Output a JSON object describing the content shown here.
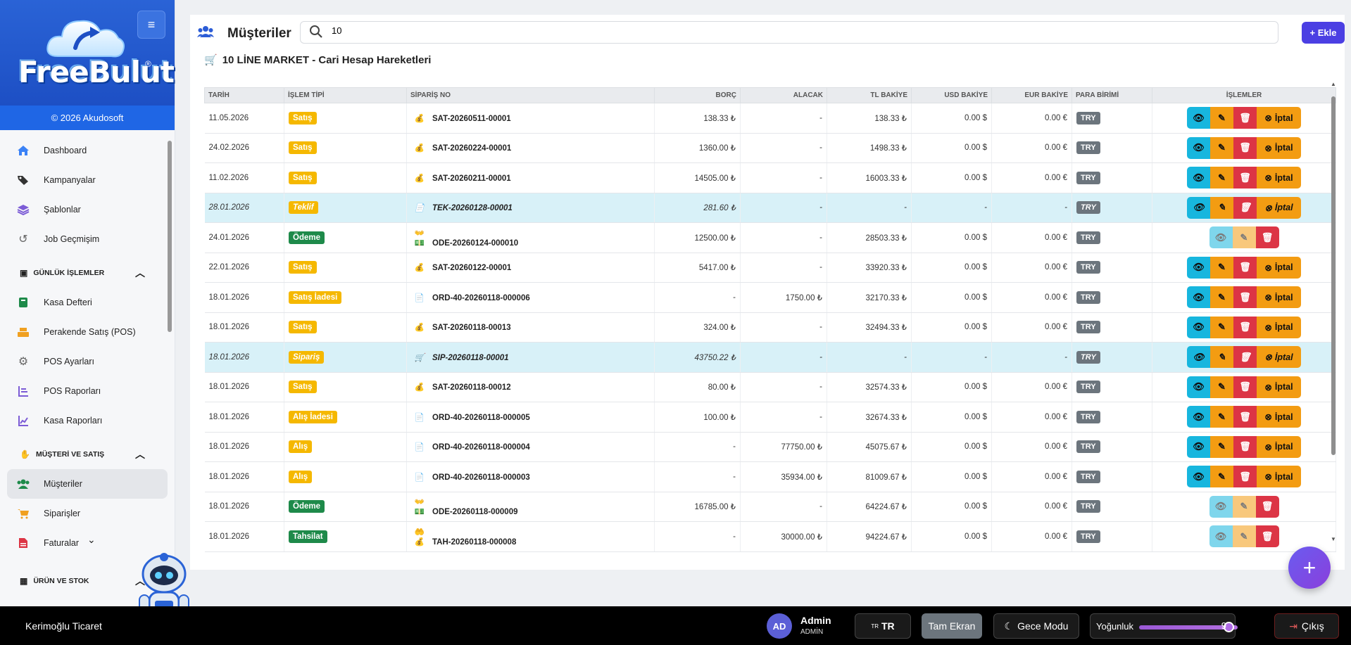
{
  "brand": {
    "logo_text": "FreeBulut",
    "reg": "®",
    "copyright": "© 2026 Akudosoft",
    "menu_icon": "hamburger-icon"
  },
  "sidebar": {
    "items": [
      {
        "label": "Dashboard",
        "icon": "home-icon",
        "color": "#3b82f6"
      },
      {
        "label": "Kampanyalar",
        "icon": "tags-icon",
        "color": "#333333"
      },
      {
        "label": "Şablonlar",
        "icon": "layers-icon",
        "color": "#7c5cd6"
      },
      {
        "label": "Job Geçmişim",
        "icon": "history-icon",
        "color": "#666666"
      }
    ],
    "section1": "GÜNLÜK İŞLEMLER",
    "items2": [
      {
        "label": "Kasa Defteri",
        "icon": "book-icon",
        "color": "#1e8a4a"
      },
      {
        "label": "Perakende Satış (POS)",
        "icon": "cash-register-icon",
        "color": "#f0a020"
      },
      {
        "label": "POS Ayarları",
        "icon": "gear-icon",
        "color": "#666666"
      },
      {
        "label": "POS Raporları",
        "icon": "list-icon",
        "color": "#7c5cd6"
      },
      {
        "label": "Kasa Raporları",
        "icon": "chart-line-icon",
        "color": "#7c5cd6"
      }
    ],
    "section2": "MÜŞTERİ VE SATIŞ",
    "items3": [
      {
        "label": "Müşteriler",
        "icon": "users-icon",
        "color": "#1e8a4a"
      },
      {
        "label": "Siparişler",
        "icon": "cart-icon",
        "color": "#f0a020"
      },
      {
        "label": "Faturalar",
        "icon": "invoice-icon",
        "color": "#dc3545"
      }
    ],
    "section3": "ÜRÜN VE STOK"
  },
  "header": {
    "title": "Müşteriler",
    "search_value": "10",
    "add_label": "+ Ekle"
  },
  "sub_title": "10 LİNE MARKET - Cari Hesap Hareketleri",
  "table": {
    "headers": [
      "TARİH",
      "İŞLEM TİPİ",
      "SİPARİŞ NO",
      "BORÇ",
      "ALACAK",
      "TL BAKİYE",
      "USD BAKİYE",
      "EUR BAKİYE",
      "PARA BİRİMİ",
      "İŞLEMLER"
    ],
    "rows": [
      {
        "date": "11.05.2026",
        "type": "Satış",
        "badge": "yellow",
        "icons": "💰",
        "no": "SAT-20260511-00001",
        "borc": "138.33 ₺",
        "alacak": "-",
        "tl": "138.33 ₺",
        "usd": "0.00 $",
        "eur": "0.00 €",
        "cur": "TRY",
        "tl_color": "red",
        "hl": false,
        "actions": "full"
      },
      {
        "date": "24.02.2026",
        "type": "Satış",
        "badge": "yellow",
        "icons": "💰",
        "no": "SAT-20260224-00001",
        "borc": "1360.00 ₺",
        "alacak": "-",
        "tl": "1498.33 ₺",
        "usd": "0.00 $",
        "eur": "0.00 €",
        "cur": "TRY",
        "tl_color": "red",
        "hl": false,
        "actions": "full"
      },
      {
        "date": "11.02.2026",
        "type": "Satış",
        "badge": "yellow",
        "icons": "💰",
        "no": "SAT-20260211-00001",
        "borc": "14505.00 ₺",
        "alacak": "-",
        "tl": "16003.33 ₺",
        "usd": "0.00 $",
        "eur": "0.00 €",
        "cur": "TRY",
        "tl_color": "red",
        "hl": false,
        "actions": "full"
      },
      {
        "date": "28.01.2026",
        "type": "Teklif",
        "badge": "yellow",
        "icons": "📄",
        "no": "TEK-20260128-00001",
        "borc": "281.60 ₺",
        "alacak": "-",
        "tl": "-",
        "usd": "-",
        "eur": "-",
        "cur": "TRY",
        "tl_color": "grey",
        "hl": true,
        "actions": "full"
      },
      {
        "date": "24.01.2026",
        "type": "Ödeme",
        "badge": "green",
        "icons": "👐💵",
        "no": "ODE-20260124-000010",
        "borc": "12500.00 ₺",
        "alacak": "-",
        "tl": "28503.33 ₺",
        "usd": "0.00 $",
        "eur": "0.00 €",
        "cur": "TRY",
        "tl_color": "red",
        "hl": false,
        "actions": "faded"
      },
      {
        "date": "22.01.2026",
        "type": "Satış",
        "badge": "yellow",
        "icons": "💰",
        "no": "SAT-20260122-00001",
        "borc": "5417.00 ₺",
        "alacak": "-",
        "tl": "33920.33 ₺",
        "usd": "0.00 $",
        "eur": "0.00 €",
        "cur": "TRY",
        "tl_color": "red",
        "hl": false,
        "actions": "full"
      },
      {
        "date": "18.01.2026",
        "type": "Satış İadesi",
        "badge": "yellow",
        "icons": "📄",
        "no": "ORD-40-20260118-000006",
        "borc": "-",
        "alacak": "1750.00 ₺",
        "tl": "32170.33 ₺",
        "usd": "0.00 $",
        "eur": "0.00 €",
        "cur": "TRY",
        "tl_color": "red",
        "hl": false,
        "actions": "full"
      },
      {
        "date": "18.01.2026",
        "type": "Satış",
        "badge": "yellow",
        "icons": "💰",
        "no": "SAT-20260118-00013",
        "borc": "324.00 ₺",
        "alacak": "-",
        "tl": "32494.33 ₺",
        "usd": "0.00 $",
        "eur": "0.00 €",
        "cur": "TRY",
        "tl_color": "red",
        "hl": false,
        "actions": "full"
      },
      {
        "date": "18.01.2026",
        "type": "Sipariş",
        "badge": "yellow",
        "icons": "🛒",
        "no": "SIP-20260118-00001",
        "borc": "43750.22 ₺",
        "alacak": "-",
        "tl": "-",
        "usd": "-",
        "eur": "-",
        "cur": "TRY",
        "tl_color": "grey",
        "hl": true,
        "actions": "full"
      },
      {
        "date": "18.01.2026",
        "type": "Satış",
        "badge": "yellow",
        "icons": "💰",
        "no": "SAT-20260118-00012",
        "borc": "80.00 ₺",
        "alacak": "-",
        "tl": "32574.33 ₺",
        "usd": "0.00 $",
        "eur": "0.00 €",
        "cur": "TRY",
        "tl_color": "red",
        "hl": false,
        "actions": "full"
      },
      {
        "date": "18.01.2026",
        "type": "Alış İadesi",
        "badge": "yellow",
        "icons": "📄",
        "no": "ORD-40-20260118-000005",
        "borc": "100.00 ₺",
        "alacak": "-",
        "tl": "32674.33 ₺",
        "usd": "0.00 $",
        "eur": "0.00 €",
        "cur": "TRY",
        "tl_color": "red",
        "hl": false,
        "actions": "full"
      },
      {
        "date": "18.01.2026",
        "type": "Alış",
        "badge": "yellow",
        "icons": "📄",
        "no": "ORD-40-20260118-000004",
        "borc": "-",
        "alacak": "77750.00 ₺",
        "tl": "45075.67 ₺",
        "usd": "0.00 $",
        "eur": "0.00 €",
        "cur": "TRY",
        "tl_color": "green",
        "hl": false,
        "actions": "full"
      },
      {
        "date": "18.01.2026",
        "type": "Alış",
        "badge": "yellow",
        "icons": "📄",
        "no": "ORD-40-20260118-000003",
        "borc": "-",
        "alacak": "35934.00 ₺",
        "tl": "81009.67 ₺",
        "usd": "0.00 $",
        "eur": "0.00 €",
        "cur": "TRY",
        "tl_color": "green",
        "hl": false,
        "actions": "full"
      },
      {
        "date": "18.01.2026",
        "type": "Ödeme",
        "badge": "green",
        "icons": "👐💵",
        "no": "ODE-20260118-000009",
        "borc": "16785.00 ₺",
        "alacak": "-",
        "tl": "64224.67 ₺",
        "usd": "0.00 $",
        "eur": "0.00 €",
        "cur": "TRY",
        "tl_color": "green",
        "hl": false,
        "actions": "faded"
      },
      {
        "date": "18.01.2026",
        "type": "Tahsilat",
        "badge": "green",
        "icons": "🤲💰",
        "no": "TAH-20260118-000008",
        "borc": "-",
        "alacak": "30000.00 ₺",
        "tl": "94224.67 ₺",
        "usd": "0.00 $",
        "eur": "0.00 €",
        "cur": "TRY",
        "tl_color": "green",
        "hl": false,
        "actions": "faded"
      }
    ],
    "cancel_label": "İptal"
  },
  "bottombar": {
    "company": "Kerimoğlu Ticaret",
    "avatar": "AD",
    "user_name": "Admin",
    "user_role": "ADMİN",
    "lang_flag": "TR",
    "lang": "TR",
    "fullscreen": "Tam Ekran",
    "night": "Gece Modu",
    "density_label": "Yoğunluk",
    "density_value": "9",
    "density_level": 0.9,
    "logout": "Çıkış"
  },
  "colors": {
    "brand_blue": "#1f66e5",
    "accent_purple": "#4b3fe3",
    "danger": "#dc3545",
    "success": "#1e8a4a",
    "warning": "#f5b800"
  }
}
